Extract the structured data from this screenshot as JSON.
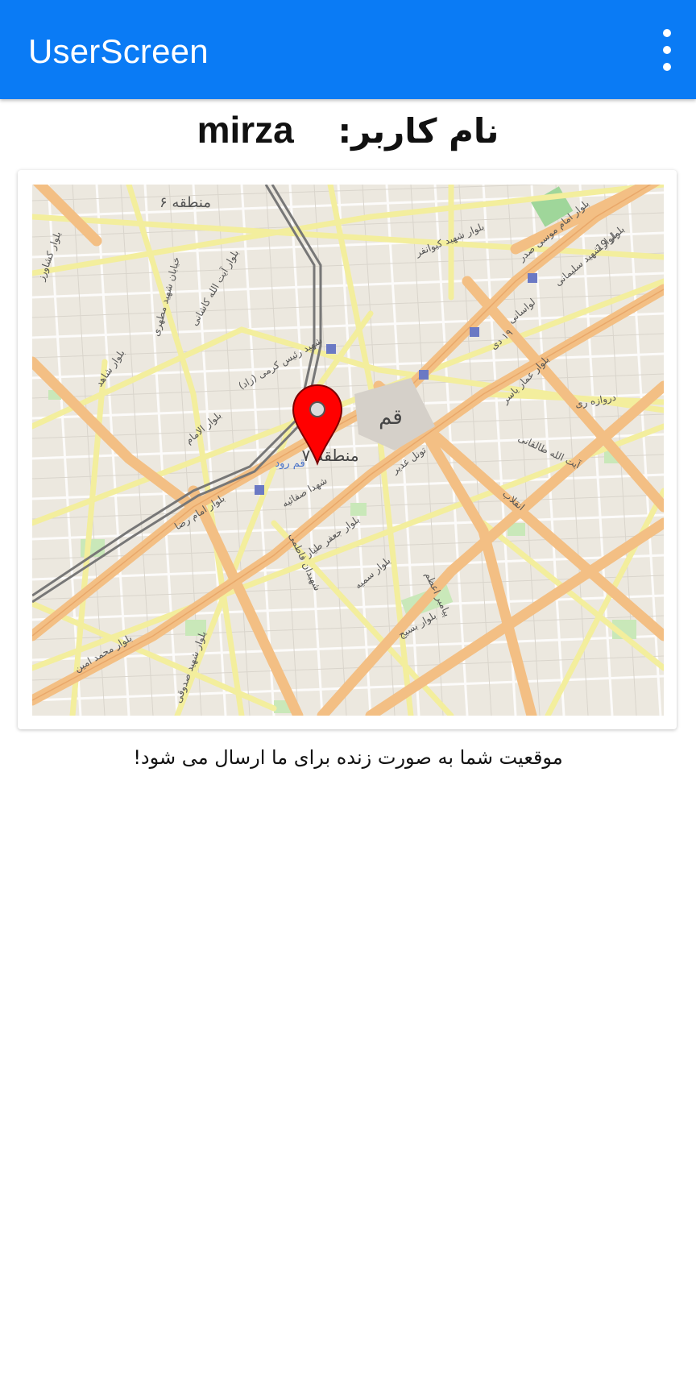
{
  "app_bar": {
    "title": "UserScreen",
    "menu_icon": "more-vert-icon",
    "background_color": "#0a7bf5"
  },
  "user": {
    "label": "نام کاربر:",
    "name": "mirza"
  },
  "map": {
    "city_label": "قم",
    "district_labels": [
      "منطقه ۶",
      "منطقه ۷"
    ],
    "river_label": "قم رود",
    "street_labels": [
      "بلوار شهید کیوانفر",
      "بلوار امام موسی صدر",
      "بلوار شهید سلیمانی",
      "بلوار آیت الله کاشانی",
      "خیابان شهید مطهری",
      "شهید رئیس کرمی (زاد)",
      "بلوار شاهد",
      "بلوار الامام",
      "بلوار امام رضا",
      "شهدا صفائیه",
      "بلوار جعفر طیار",
      "شهیدان فاطمی",
      "بلوار سمیه",
      "پیامبر اعظم",
      "تونل غدیر",
      "انقلاب",
      "آیت الله طالقانی",
      "دروازه ری",
      "بلوار عمار یاسر",
      "بلوار بسیج",
      "بلوار محمد امین",
      "بلوار شهید صدوقی",
      "۱۹ دی",
      "لواسانی",
      "بلوار 19",
      "بلوار کشاورز"
    ],
    "pin_icon": "location-pin-icon",
    "pin_color": "#ff0000"
  },
  "caption": "موقعیت شما به صورت زنده برای ما ارسال می شود!"
}
